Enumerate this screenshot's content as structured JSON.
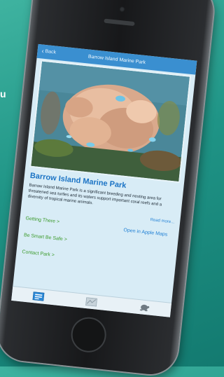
{
  "background": {
    "partial_text": "u",
    "accent": "#1f9486"
  },
  "navbar": {
    "back_label": "Back",
    "title": "Barrow Island Marine Park"
  },
  "hero": {
    "image": "coral-reef-photo"
  },
  "park": {
    "title": "Barrow Island Marine Park",
    "description": "Barrow Island Marine Park is a significant breeding and nesting area for threatened sea turtles and its waters support important coral reefs and a diversity of tropical marine animals.",
    "read_more": "Read more..."
  },
  "links": {
    "getting_there": "Getting There >",
    "open_maps": "Open in Apple Maps",
    "be_smart": "Be Smart Be Safe >",
    "contact": "Contact Park >"
  },
  "tabbar": {
    "icons": [
      "list-icon",
      "map-icon",
      "turtle-icon"
    ]
  },
  "colors": {
    "nav": "#3a8fd0",
    "title": "#1c74c5",
    "link_green": "#3b9a2a",
    "link_blue": "#1f7fd4"
  }
}
